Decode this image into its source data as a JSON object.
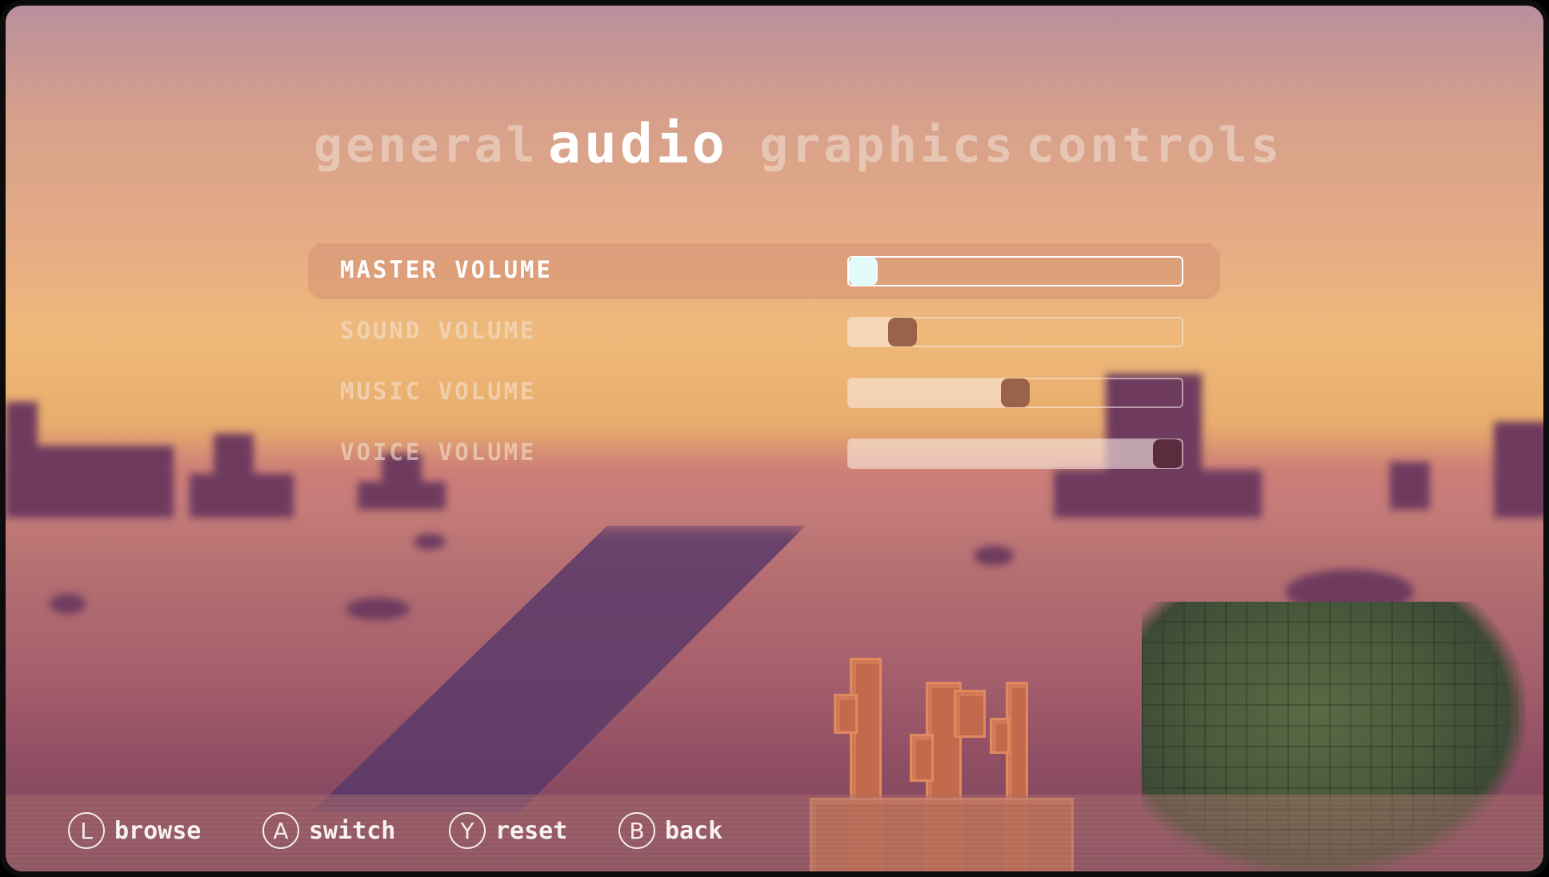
{
  "tabs": [
    {
      "label": "general",
      "active": false
    },
    {
      "label": "audio",
      "active": true
    },
    {
      "label": "graphics",
      "active": false
    },
    {
      "label": "controls",
      "active": false
    }
  ],
  "settings": [
    {
      "label": "MASTER VOLUME",
      "value": 0.0,
      "selected": true
    },
    {
      "label": "SOUND VOLUME",
      "value": 0.13,
      "selected": false
    },
    {
      "label": "MUSIC VOLUME",
      "value": 0.5,
      "selected": false
    },
    {
      "label": "VOICE VOLUME",
      "value": 1.0,
      "selected": false
    }
  ],
  "hints": [
    {
      "button": "L",
      "label": "browse"
    },
    {
      "button": "A",
      "label": "switch"
    },
    {
      "button": "Y",
      "label": "reset"
    },
    {
      "button": "B",
      "label": "back"
    }
  ],
  "colors": {
    "active_text": "#ffffff",
    "inactive_text": "#f0e1d7",
    "selected_knob": "#e3fbfb",
    "knob": "#9a6248"
  }
}
